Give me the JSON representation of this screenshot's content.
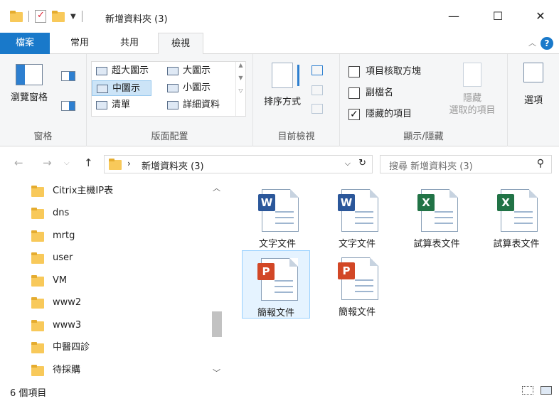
{
  "window": {
    "title": "新增資料夾 (3)",
    "minimize": "—",
    "maximize": "☐",
    "close": "✕"
  },
  "ribbon_tabs": [
    "檔案",
    "常用",
    "共用",
    "檢視"
  ],
  "ribbon": {
    "pane_group": {
      "label": "窗格",
      "nav_pane": "瀏覽窗格"
    },
    "layout_group": {
      "label": "版面配置",
      "items": [
        "超大圖示",
        "大圖示",
        "中圖示",
        "小圖示",
        "清單",
        "詳細資料"
      ],
      "selected": "中圖示"
    },
    "current_view_group": {
      "label": "目前檢視",
      "sort_by": "排序方式"
    },
    "show_hide_group": {
      "label": "顯示/隱藏",
      "checkboxes": [
        {
          "label": "項目核取方塊",
          "checked": false
        },
        {
          "label": "副檔名",
          "checked": false
        },
        {
          "label": "隱藏的項目",
          "checked": true
        }
      ],
      "hide_selected": [
        "隱藏",
        "選取的項目"
      ]
    },
    "options": "選項"
  },
  "address": {
    "path": "新增資料夾 (3)",
    "search_placeholder": "搜尋 新增資料夾 (3)"
  },
  "nav_items": [
    "Citrix主機IP表",
    "dns",
    "mrtg",
    "user",
    "VM",
    "www2",
    "www3",
    "中醫四診",
    "待採購"
  ],
  "files": [
    {
      "name": "文字文件",
      "icon": "word-doc-icon",
      "type": "w",
      "letter": "W"
    },
    {
      "name": "文字文件",
      "icon": "word-doc-icon",
      "type": "w",
      "letter": "W"
    },
    {
      "name": "試算表文件",
      "icon": "excel-doc-icon",
      "type": "x",
      "letter": "X"
    },
    {
      "name": "試算表文件",
      "icon": "excel-doc-icon",
      "type": "x",
      "letter": "X"
    },
    {
      "name": "簡報文件",
      "icon": "ppt-doc-icon",
      "type": "p",
      "letter": "P"
    },
    {
      "name": "簡報文件",
      "icon": "ppt-doc-icon",
      "type": "p",
      "letter": "P"
    }
  ],
  "status": {
    "count": "6 個項目"
  }
}
